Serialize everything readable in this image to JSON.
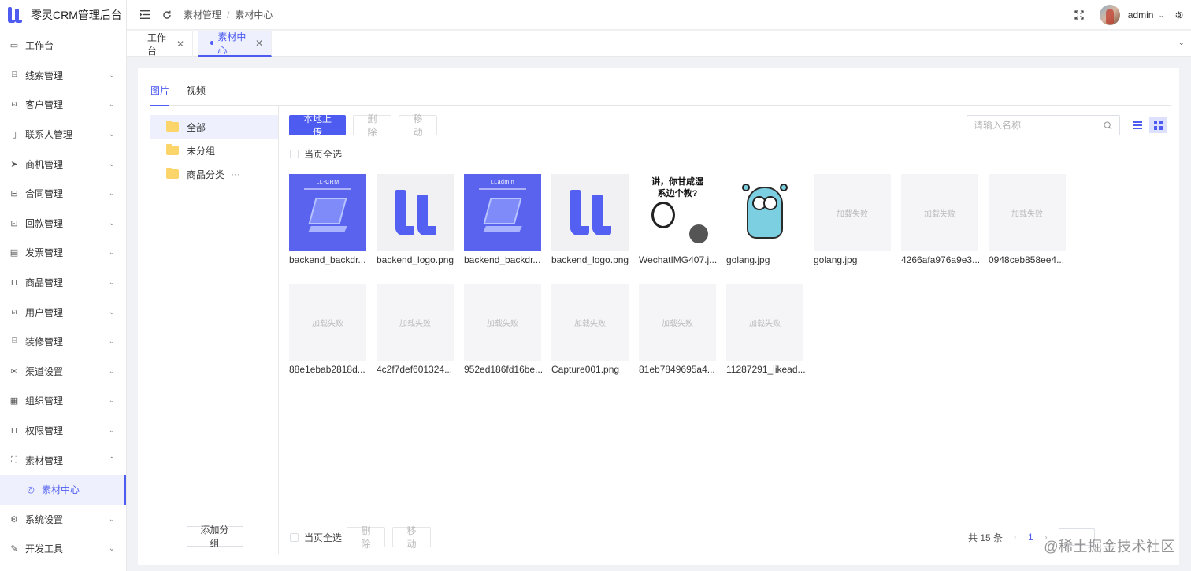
{
  "app": {
    "title": "零灵CRM管理后台"
  },
  "sidebar": {
    "items": [
      {
        "label": "工作台",
        "icon": "monitor-icon",
        "has_children": false
      },
      {
        "label": "线索管理",
        "icon": "clue-icon",
        "has_children": true
      },
      {
        "label": "客户管理",
        "icon": "user-icon",
        "has_children": true
      },
      {
        "label": "联系人管理",
        "icon": "contact-book-icon",
        "has_children": true
      },
      {
        "label": "商机管理",
        "icon": "send-icon",
        "has_children": true
      },
      {
        "label": "合同管理",
        "icon": "contract-icon",
        "has_children": true
      },
      {
        "label": "回款管理",
        "icon": "payment-icon",
        "has_children": true
      },
      {
        "label": "发票管理",
        "icon": "invoice-icon",
        "has_children": true
      },
      {
        "label": "商品管理",
        "icon": "bag-icon",
        "has_children": true
      },
      {
        "label": "用户管理",
        "icon": "user-icon",
        "has_children": true
      },
      {
        "label": "装修管理",
        "icon": "decor-icon",
        "has_children": true
      },
      {
        "label": "渠道设置",
        "icon": "mail-icon",
        "has_children": true
      },
      {
        "label": "组织管理",
        "icon": "org-icon",
        "has_children": true
      },
      {
        "label": "权限管理",
        "icon": "lock-icon",
        "has_children": true
      },
      {
        "label": "素材管理",
        "icon": "image-icon",
        "has_children": true,
        "expanded": true
      },
      {
        "label": "素材中心",
        "icon": "compass-icon",
        "sub": true,
        "active": true
      },
      {
        "label": "系统设置",
        "icon": "gear-icon",
        "has_children": true
      },
      {
        "label": "开发工具",
        "icon": "tool-icon",
        "has_children": true
      }
    ]
  },
  "header": {
    "breadcrumb": [
      "素材管理",
      "素材中心"
    ],
    "user_name": "admin"
  },
  "tabs": [
    {
      "label": "工作台",
      "active": false
    },
    {
      "label": "素材中心",
      "active": true
    }
  ],
  "media_tabs": [
    {
      "label": "图片",
      "active": true
    },
    {
      "label": "视频",
      "active": false
    }
  ],
  "groups": {
    "items": [
      {
        "label": "全部",
        "active": true
      },
      {
        "label": "未分组",
        "active": false
      },
      {
        "label": "商品分类",
        "active": false,
        "more": "···"
      }
    ],
    "add_label": "添加分组"
  },
  "toolbar": {
    "upload_label": "本地上传",
    "delete_label": "删除",
    "move_label": "移动",
    "search_placeholder": "请输入名称",
    "select_all_label": "当页全选"
  },
  "files": [
    {
      "name": "backend_backdr...",
      "thumb": "banner",
      "banner_title": "LL-CRM"
    },
    {
      "name": "backend_logo.png",
      "thumb": "ll-logo"
    },
    {
      "name": "backend_backdr...",
      "thumb": "banner",
      "banner_title": "LLadmin"
    },
    {
      "name": "backend_logo.png",
      "thumb": "ll-logo"
    },
    {
      "name": "WechatIMG407.j...",
      "thumb": "meme",
      "caption": "讲，你甘咸湿\n系边个教?"
    },
    {
      "name": "golang.jpg",
      "thumb": "gopher"
    },
    {
      "name": "golang.jpg",
      "thumb": "failed",
      "failed_text": "加载失败"
    },
    {
      "name": "4266afa976a9e3...",
      "thumb": "failed",
      "failed_text": "加载失败"
    },
    {
      "name": "0948ceb858ee4...",
      "thumb": "failed",
      "failed_text": "加载失败"
    },
    {
      "name": "88e1ebab2818d...",
      "thumb": "failed",
      "failed_text": "加载失败"
    },
    {
      "name": "4c2f7def601324...",
      "thumb": "failed",
      "failed_text": "加载失败"
    },
    {
      "name": "952ed186fd16be...",
      "thumb": "failed",
      "failed_text": "加载失败"
    },
    {
      "name": "Capture001.png",
      "thumb": "failed",
      "failed_text": "加载失败"
    },
    {
      "name": "81eb7849695a4...",
      "thumb": "failed",
      "failed_text": "加载失败"
    },
    {
      "name": "11287291_likead...",
      "thumb": "failed",
      "failed_text": "加载失败"
    }
  ],
  "footer": {
    "select_all_label": "当页全选",
    "delete_label": "删除",
    "move_label": "移动",
    "total_label": "共 15 条",
    "current_page": "1"
  },
  "watermark": "@稀土掘金技术社区",
  "colors": {
    "accent": "#4d5bf0",
    "accent_bg": "#eef0fe"
  }
}
